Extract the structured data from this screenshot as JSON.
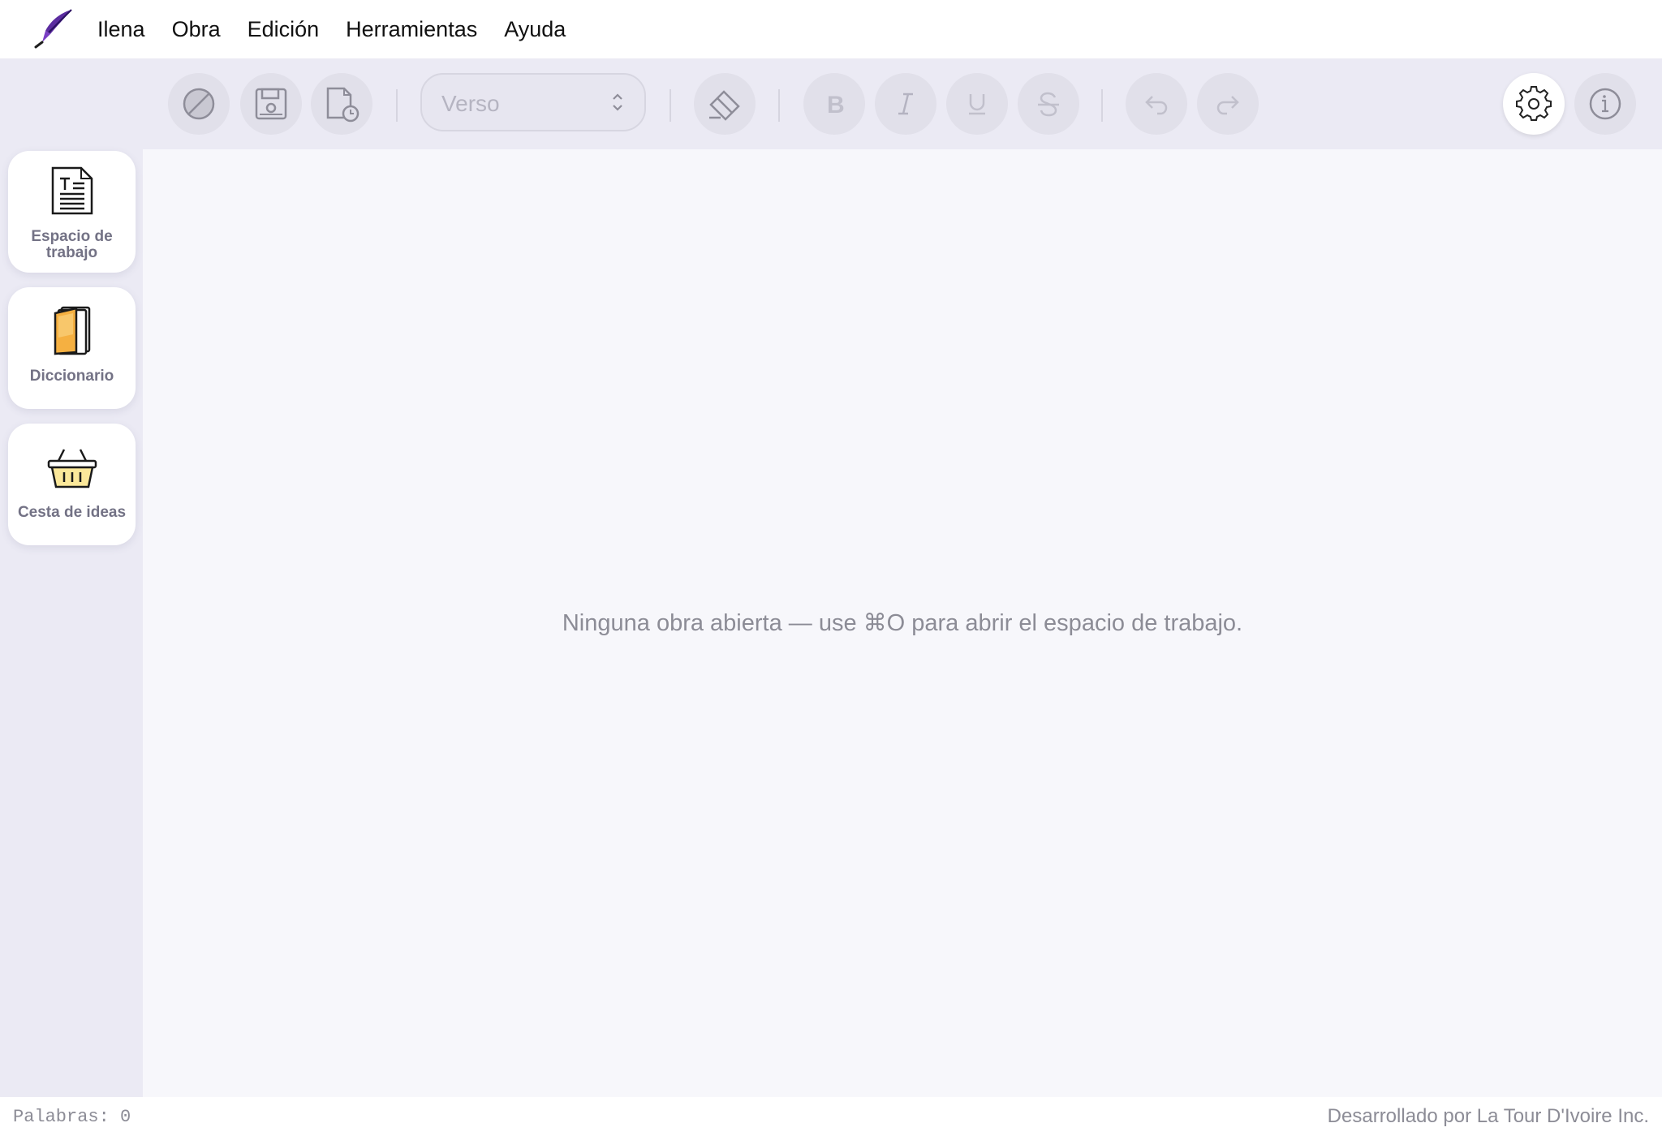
{
  "menubar": {
    "logo_icon": "quill-pen-icon",
    "items": [
      {
        "label": "Ilena"
      },
      {
        "label": "Obra"
      },
      {
        "label": "Edición"
      },
      {
        "label": "Herramientas"
      },
      {
        "label": "Ayuda"
      }
    ]
  },
  "toolbar": {
    "buttons": {
      "cancel": "cancel-icon",
      "save": "floppy-disk-icon",
      "history": "file-history-icon",
      "eraser": "eraser-icon",
      "bold": "bold-icon",
      "italic": "italic-icon",
      "underline": "underline-icon",
      "strikethrough": "strikethrough-icon",
      "undo": "undo-icon",
      "redo": "redo-icon",
      "settings": "gear-icon",
      "info": "info-icon"
    },
    "style_select": {
      "value": "Verso"
    }
  },
  "sidebar": {
    "items": [
      {
        "label": "Espacio de trabajo",
        "icon": "document-icon"
      },
      {
        "label": "Diccionario",
        "icon": "book-icon"
      },
      {
        "label": "Cesta de ideas",
        "icon": "basket-icon"
      }
    ]
  },
  "main": {
    "empty_message": "Ninguna obra abierta — use ⌘O para abrir el espacio de trabajo."
  },
  "statusbar": {
    "word_count": "Palabras: 0",
    "credits": "Desarrollado por La Tour D'Ivoire Inc."
  },
  "colors": {
    "chrome_bg": "#ebeaf4",
    "editor_bg": "#f7f7fb",
    "muted_text": "#8c8c96",
    "disabled_icon": "#b9b8c6",
    "book_accent": "#f5b041",
    "basket_accent": "#fbe89a"
  }
}
